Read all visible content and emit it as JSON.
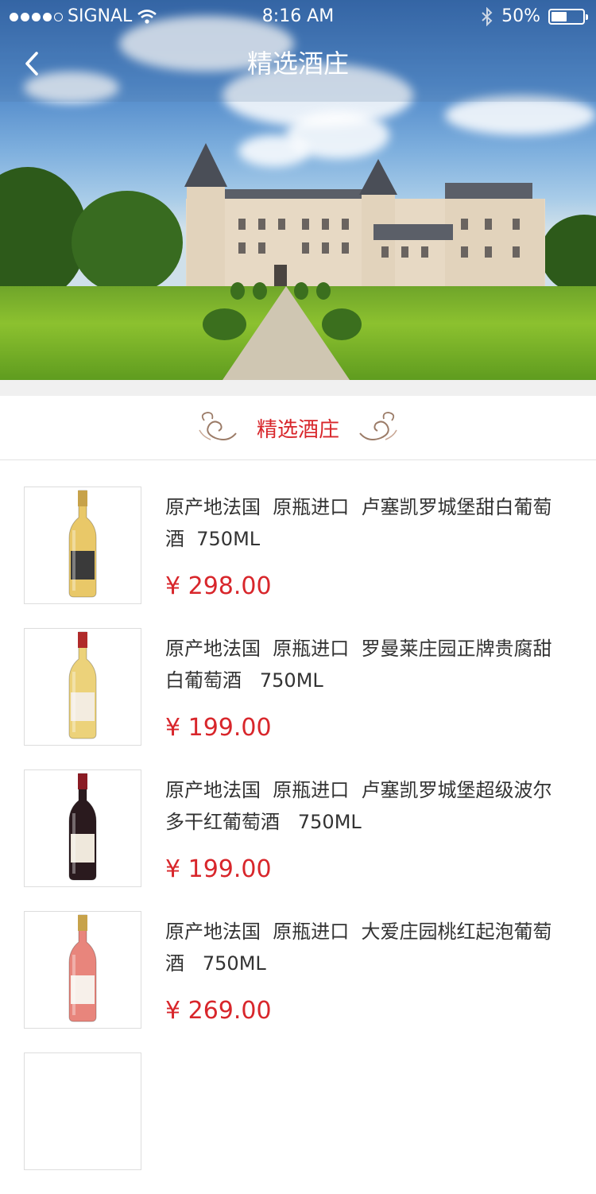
{
  "status_bar": {
    "carrier": "SIGNAL",
    "time": "8:16 AM",
    "battery": "50%",
    "battery_level": 0.5
  },
  "nav": {
    "title": "精选酒庄",
    "back_icon": "chevron-left-icon"
  },
  "section": {
    "title": "精选酒庄"
  },
  "products": [
    {
      "title": "原产地法国  原瓶进口  卢塞凯罗城堡甜白葡萄酒  750ML",
      "price": "¥ 298.00",
      "bottle_color": "#e9c868",
      "label_color": "#3a3a3a"
    },
    {
      "title": "原产地法国  原瓶进口  罗曼莱庄园正牌贵腐甜白葡萄酒   750ML",
      "price": "¥ 199.00",
      "bottle_color": "#ecd27a",
      "label_color": "#f3ece0"
    },
    {
      "title": "原产地法国  原瓶进口  卢塞凯罗城堡超级波尔多干红葡萄酒   750ML",
      "price": "¥ 199.00",
      "bottle_color": "#2a1a1e",
      "label_color": "#efe8dc"
    },
    {
      "title": "原产地法国  原瓶进口  大爱庄园桃红起泡葡萄酒   750ML",
      "price": "¥ 269.00",
      "bottle_color": "#e8857c",
      "label_color": "#f7f0ea"
    }
  ]
}
